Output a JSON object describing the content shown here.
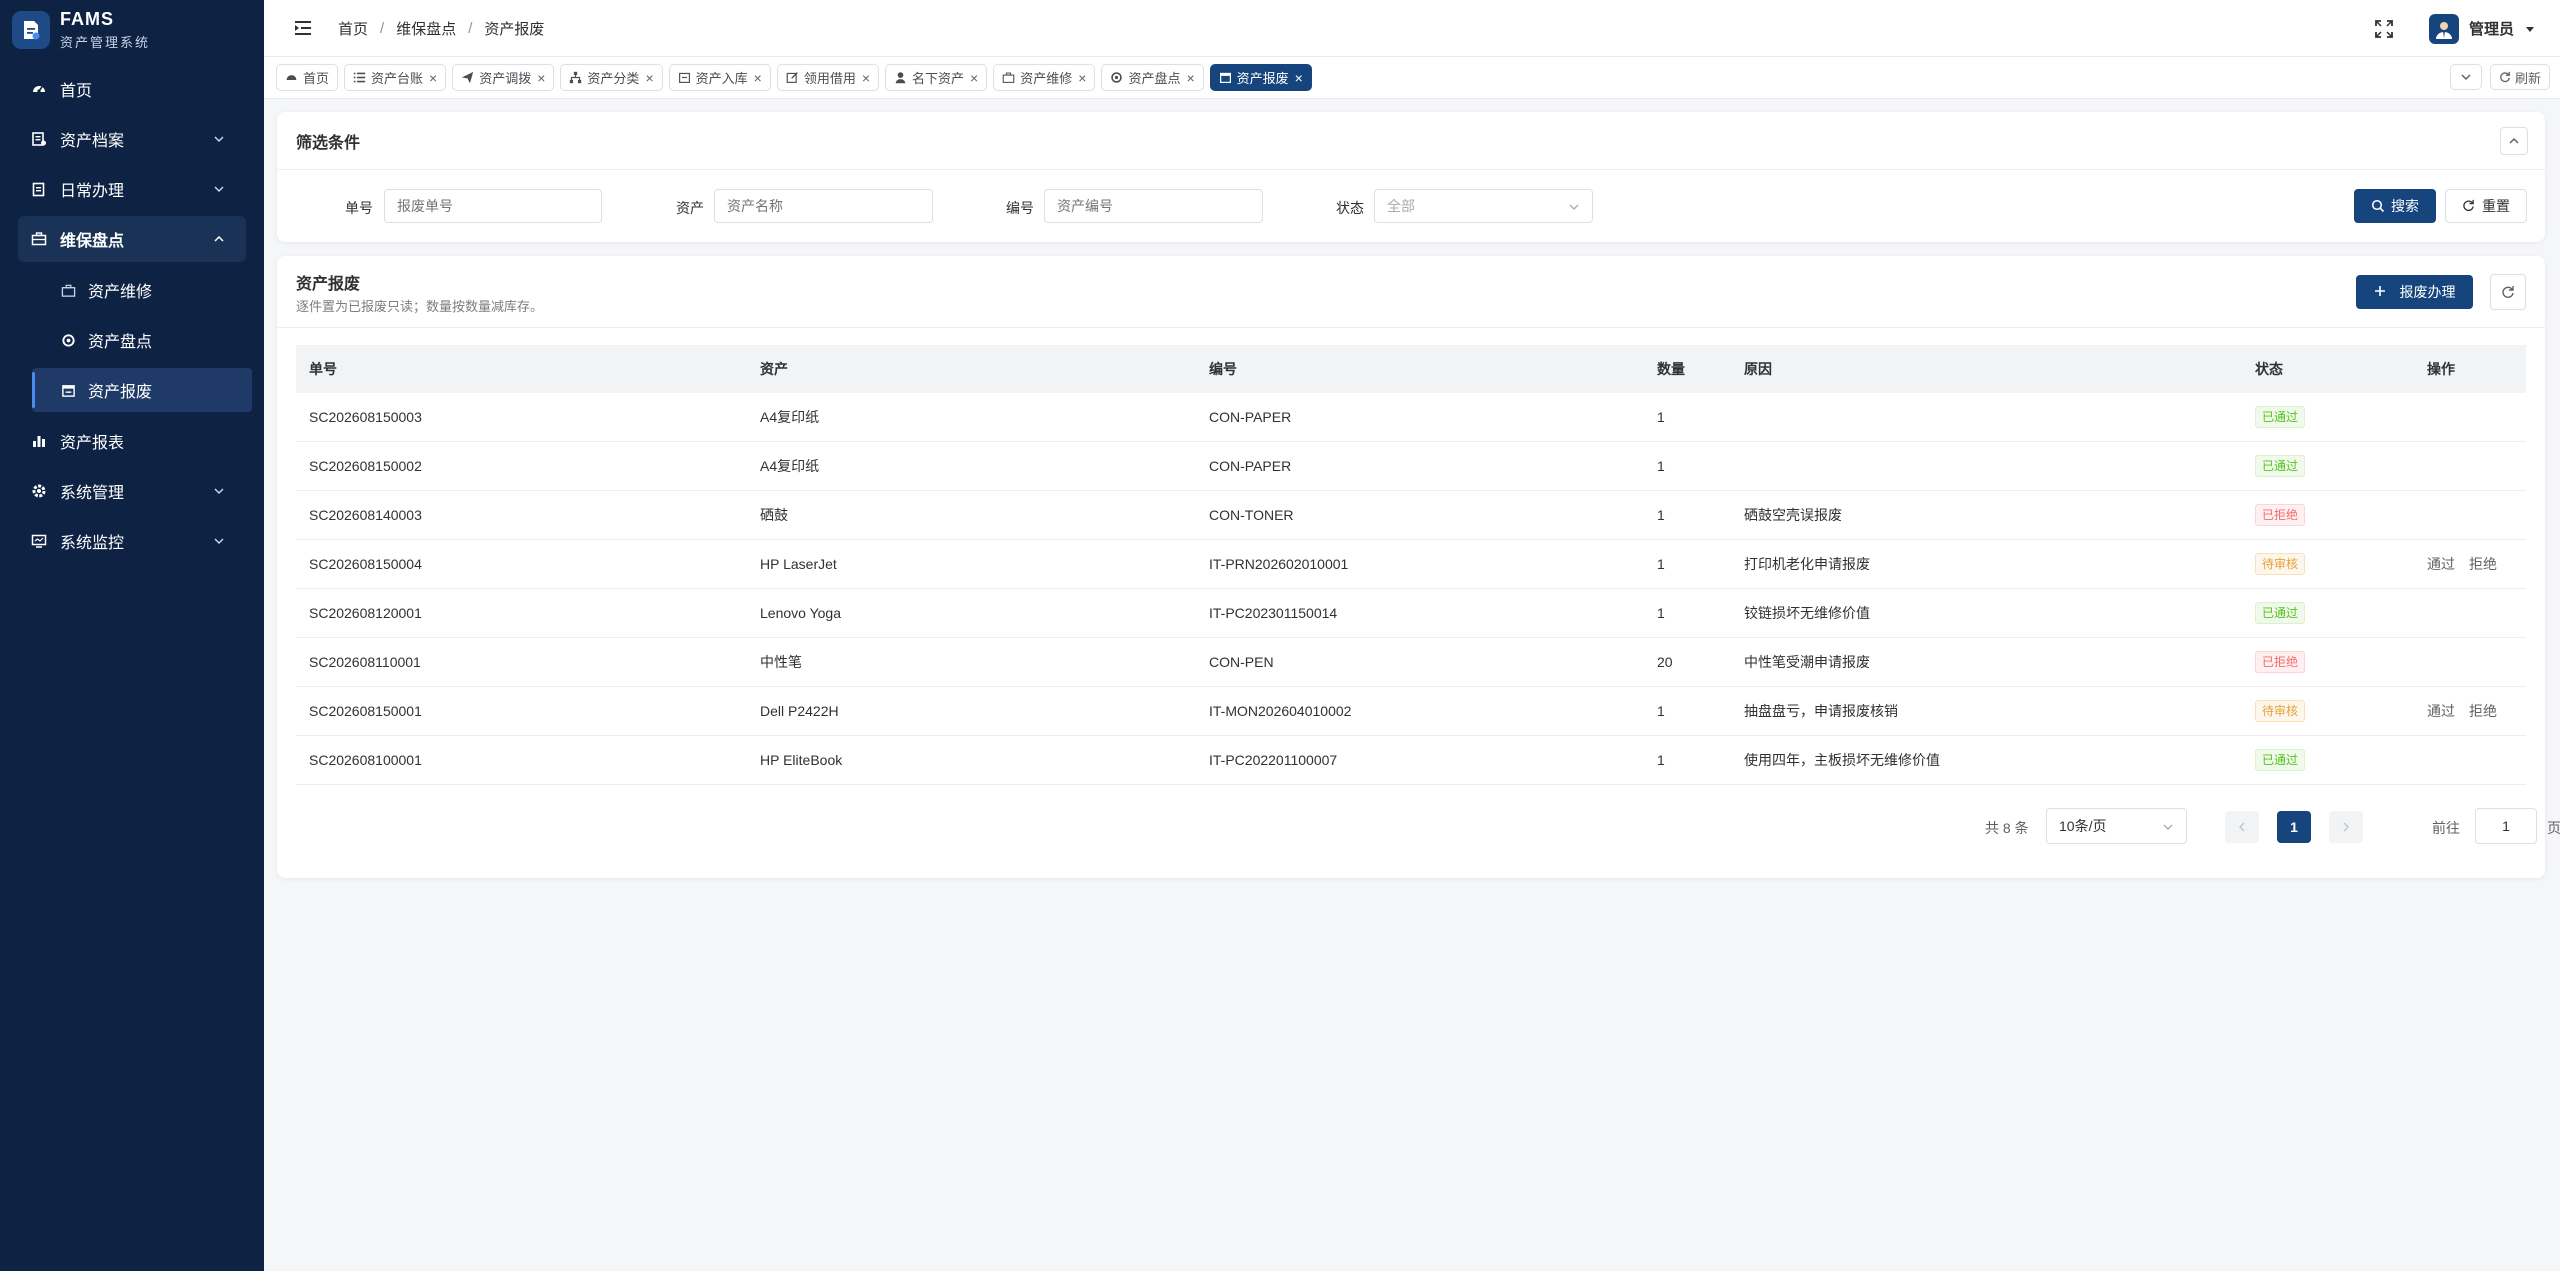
{
  "brand": {
    "title": "FAMS",
    "subtitle": "资产管理系统"
  },
  "sidebar": {
    "items": [
      {
        "label": "首页",
        "icon": "dashboard-icon"
      },
      {
        "label": "资产档案",
        "icon": "archive-icon"
      },
      {
        "label": "日常办理",
        "icon": "clipboard-icon"
      },
      {
        "label": "维保盘点",
        "icon": "briefcase-icon"
      },
      {
        "label": "资产报表",
        "icon": "bar-chart-icon"
      },
      {
        "label": "系统管理",
        "icon": "gear-icon"
      },
      {
        "label": "系统监控",
        "icon": "monitor-icon"
      }
    ],
    "subitems": [
      {
        "label": "资产维修",
        "icon": "toolbox-icon"
      },
      {
        "label": "资产盘点",
        "icon": "refresh-icon"
      },
      {
        "label": "资产报废",
        "icon": "calendar-x-icon"
      }
    ]
  },
  "header": {
    "breadcrumb": [
      "首页",
      "维保盘点",
      "资产报废"
    ],
    "breadcrumb_sep": "/",
    "user": "管理员"
  },
  "tabs": [
    {
      "label": "首页"
    },
    {
      "label": "资产台账"
    },
    {
      "label": "资产调拨"
    },
    {
      "label": "资产分类"
    },
    {
      "label": "资产入库"
    },
    {
      "label": "领用借用"
    },
    {
      "label": "名下资产"
    },
    {
      "label": "资产维修"
    },
    {
      "label": "资产盘点"
    },
    {
      "label": "资产报废"
    }
  ],
  "tabs_refresh": "刷新",
  "filter": {
    "title": "筛选条件",
    "fields": [
      {
        "label": "单号",
        "placeholder": "报废单号"
      },
      {
        "label": "资产",
        "placeholder": "资产名称"
      },
      {
        "label": "编号",
        "placeholder": "资产编号"
      },
      {
        "label": "状态",
        "value": "全部"
      }
    ],
    "search": "搜索",
    "reset": "重置"
  },
  "main": {
    "title": "资产报废",
    "subtitle": "逐件置为已报废只读；数量按数量减库存。",
    "add_button": "报废办理",
    "columns": [
      "单号",
      "资产",
      "编号",
      "数量",
      "原因",
      "状态",
      "操作"
    ],
    "rows": [
      {
        "no": "SC202608150003",
        "asset": "A4复印纸",
        "code": "CON-PAPER",
        "qty": "1",
        "reason": "",
        "status": "已通过",
        "kind": "ok"
      },
      {
        "no": "SC202608150002",
        "asset": "A4复印纸",
        "code": "CON-PAPER",
        "qty": "1",
        "reason": "",
        "status": "已通过",
        "kind": "ok"
      },
      {
        "no": "SC202608140003",
        "asset": "硒鼓",
        "code": "CON-TONER",
        "qty": "1",
        "reason": "硒鼓空壳误报废",
        "status": "已拒绝",
        "kind": "no"
      },
      {
        "no": "SC202608150004",
        "asset": "HP LaserJet",
        "code": "IT-PRN202602010001",
        "qty": "1",
        "reason": "打印机老化申请报废",
        "status": "待审核",
        "kind": "wait"
      },
      {
        "no": "SC202608120001",
        "asset": "Lenovo Yoga",
        "code": "IT-PC202301150014",
        "qty": "1",
        "reason": "铰链损坏无维修价值",
        "status": "已通过",
        "kind": "ok"
      },
      {
        "no": "SC202608110001",
        "asset": "中性笔",
        "code": "CON-PEN",
        "qty": "20",
        "reason": "中性笔受潮申请报废",
        "status": "已拒绝",
        "kind": "no"
      },
      {
        "no": "SC202608150001",
        "asset": "Dell P2422H",
        "code": "IT-MON202604010002",
        "qty": "1",
        "reason": "抽盘盘亏，申请报废核销",
        "status": "待审核",
        "kind": "wait"
      },
      {
        "no": "SC202608100001",
        "asset": "HP EliteBook",
        "code": "IT-PC202201100007",
        "qty": "1",
        "reason": "使用四年，主板损坏无维修价值",
        "status": "已通过",
        "kind": "ok"
      }
    ],
    "op_approve": "通过",
    "op_reject": "拒绝"
  },
  "pager": {
    "total": "共 8 条",
    "page_size": "10条/页",
    "current": "1",
    "goto_label": "前往",
    "goto_value": "1",
    "goto_unit": "页"
  },
  "colors": {
    "sidebar_bg": "#0e2243",
    "primary": "#16457e",
    "ok": "#52c41a",
    "danger": "#f56c6c",
    "warning": "#e6a23c"
  }
}
